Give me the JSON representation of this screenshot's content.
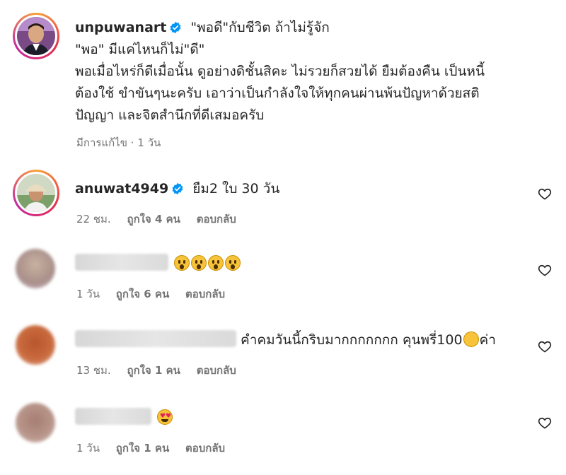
{
  "post": {
    "username": "unpuwanart",
    "caption_line1": "\"พอดี\"กับชีวิต ถ้าไม่รู้จัก",
    "caption_line2": "\"พอ\" มีแค่ไหนก็ไม่\"ดี\"",
    "caption_line3": "พอเมื่อไหร่ก็ดีเมื่อนั้น ดูอย่างดิชั้นสิคะ ไม่รวยก็สวยได้ ยืมต้องคืน เป็นหนี้",
    "caption_line4": "ต้องใช้ ขำขันๆนะครับ เอาว่าเป็นกำลังใจให้ทุกคนผ่านพ้นปัญหาด้วยสติ",
    "caption_line5": "ปัญญา และจิตสำนึกที่ดีเสมอครับ",
    "meta": "มีการแก้ไข · 1 วัน"
  },
  "comments": [
    {
      "username": "anuwat4949",
      "text": "ยืม2 ใบ 30 วัน",
      "time": "22 ชม.",
      "likes": "ถูกใจ 4 คน",
      "reply": "ตอบกลับ"
    },
    {
      "username": "",
      "text": "",
      "emoji": "😮😮😮😮",
      "time": "1 วัน",
      "likes": "ถูกใจ 6 คน",
      "reply": "ตอบกลับ"
    },
    {
      "username": "",
      "text": "คำคมวันนี้กริบมากกกกกกก คุนพรี่100",
      "text_end": "ค่า",
      "emoji": "👏",
      "time": "13 ชม.",
      "likes": "ถูกใจ 1 คน",
      "reply": "ตอบกลับ"
    },
    {
      "username": "",
      "text": "",
      "emoji": "😍",
      "time": "1 วัน",
      "likes": "ถูกใจ 1 คน",
      "reply": "ตอบกลับ"
    }
  ],
  "icons": {
    "verified": "verified-badge-icon",
    "heart": "heart-outline-icon"
  },
  "colors": {
    "verified": "#0095f6",
    "text": "#262626",
    "muted": "#737373"
  }
}
